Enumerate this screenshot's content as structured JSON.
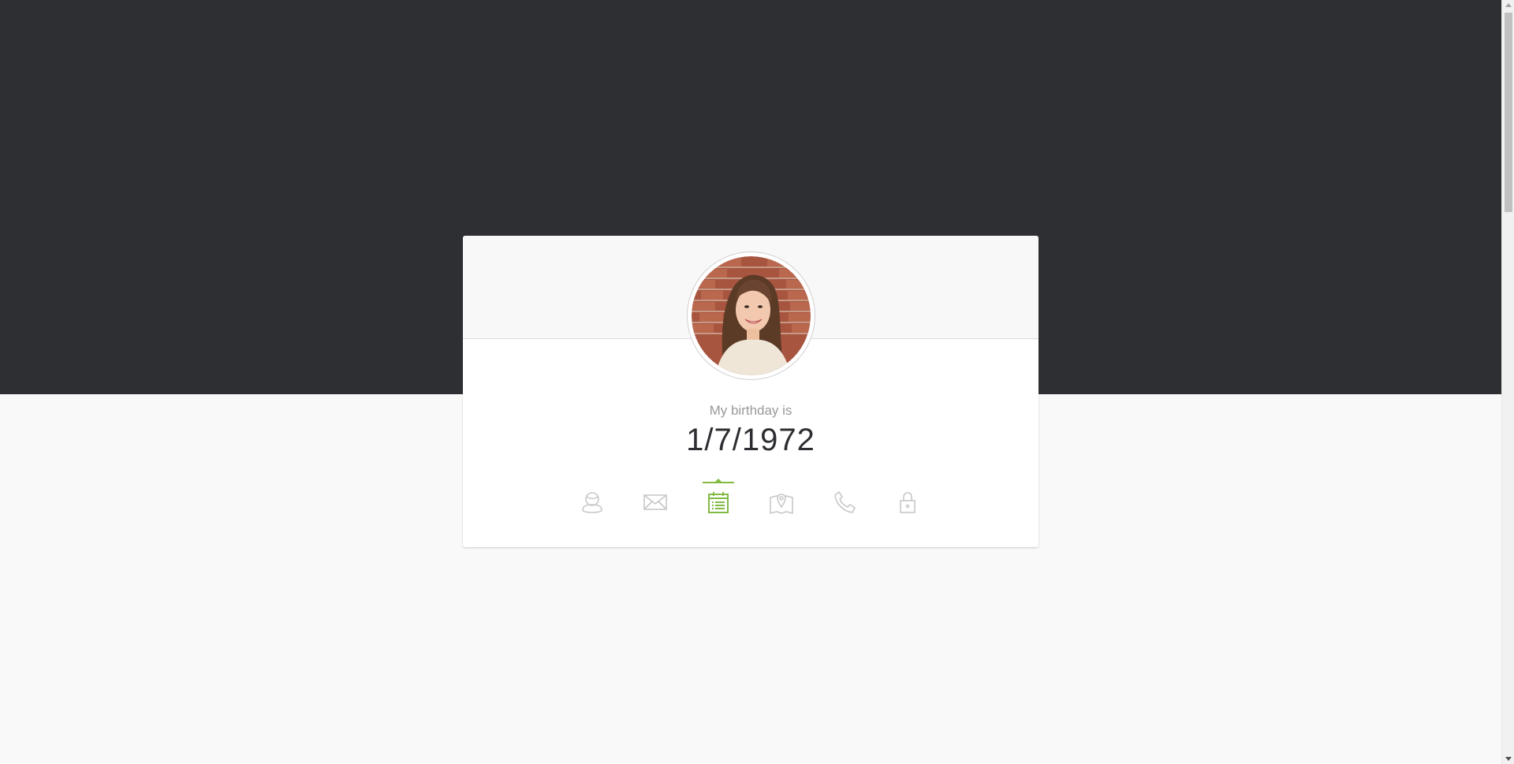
{
  "profile": {
    "label": "My birthday is",
    "value": "1/7/1972",
    "avatar_alt": "user photo"
  },
  "nav": {
    "items": [
      {
        "name": "name-icon",
        "active": false
      },
      {
        "name": "email-icon",
        "active": false
      },
      {
        "name": "birthday-icon",
        "active": true
      },
      {
        "name": "location-icon",
        "active": false
      },
      {
        "name": "phone-icon",
        "active": false
      },
      {
        "name": "password-icon",
        "active": false
      }
    ]
  },
  "colors": {
    "header_band": "#2e2f33",
    "page_bg": "#f9f9f9",
    "accent": "#83ba43",
    "icon_inactive": "#c8c8c8",
    "value_text": "#2c2e31",
    "label_text": "#999999"
  }
}
